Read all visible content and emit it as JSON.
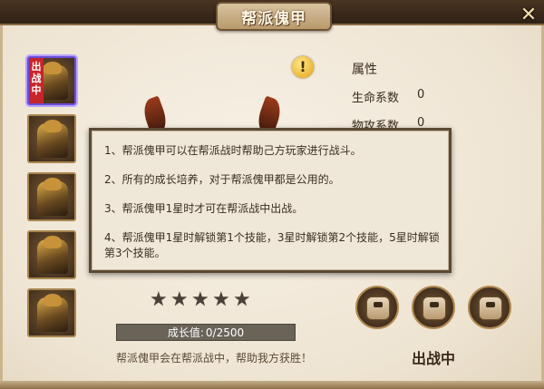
{
  "window": {
    "title": "帮派傀甲",
    "close_icon": "close-x-icon"
  },
  "side_list": {
    "active_tag": "出战中",
    "items": [
      "warrior-1-icon",
      "warrior-2-icon",
      "warrior-3-icon",
      "warrior-4-icon",
      "warrior-5-icon"
    ]
  },
  "attributes": {
    "header": "属性",
    "rows": [
      {
        "label": "生命系数",
        "value": "0"
      },
      {
        "label": "物攻系数",
        "value": "0"
      }
    ]
  },
  "tooltip": {
    "lines": [
      "1、帮派傀甲可以在帮派战时帮助己方玩家进行战斗。",
      "2、所有的成长培养，对于帮派傀甲都是公用的。",
      "3、帮派傀甲1星时才可在帮派战中出战。",
      "4、帮派傀甲1星时解锁第1个技能，3星时解锁第2个技能，5星时解锁第3个技能。"
    ]
  },
  "stars": {
    "count": 5,
    "filled": 0
  },
  "growth": {
    "label": "成长值:",
    "value": "0/2500"
  },
  "footer_text": "帮派傀甲会在帮派战中，帮助我方获胜！",
  "skills": [
    "locked-skill-icon",
    "locked-skill-icon",
    "locked-skill-icon"
  ],
  "deploy_status": "出战中"
}
